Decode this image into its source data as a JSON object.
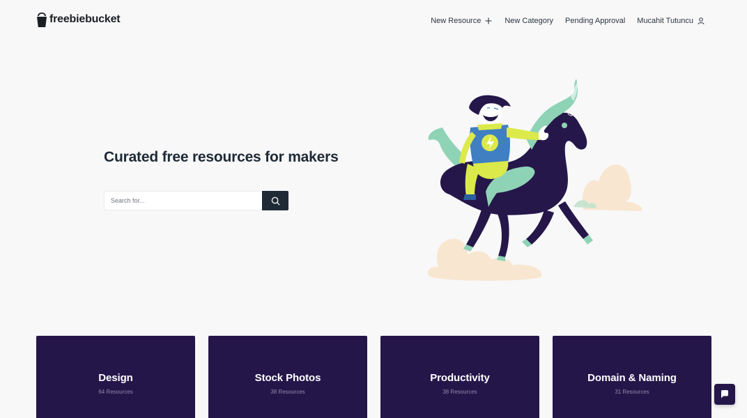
{
  "brand": {
    "name": "freebiebucket"
  },
  "nav": {
    "items": [
      {
        "label": "New Resource",
        "icon": "plus-icon"
      },
      {
        "label": "New Category"
      },
      {
        "label": "Pending Approval"
      },
      {
        "label": "Mucahit Tutuncu",
        "icon": "user-icon"
      }
    ]
  },
  "hero": {
    "title": "Curated free resources for makers",
    "search_placeholder": "Search for...",
    "search_icon": "search-icon"
  },
  "categories": [
    {
      "title": "Design",
      "count": "64 Resources"
    },
    {
      "title": "Stock Photos",
      "count": "38 Resources"
    },
    {
      "title": "Productivity",
      "count": "38 Resources"
    },
    {
      "title": "Domain & Naming",
      "count": "31 Resources"
    }
  ],
  "chat": {
    "icon": "chat-icon"
  },
  "colors": {
    "background": "#f8f8f9",
    "card": "#25164a",
    "search_button": "#1f2a36",
    "horse": "#25174a",
    "mint": "#8fd3b6",
    "cloud": "#f8e6d0",
    "shirt": "#3f7fc2",
    "yellow": "#dce94a"
  }
}
